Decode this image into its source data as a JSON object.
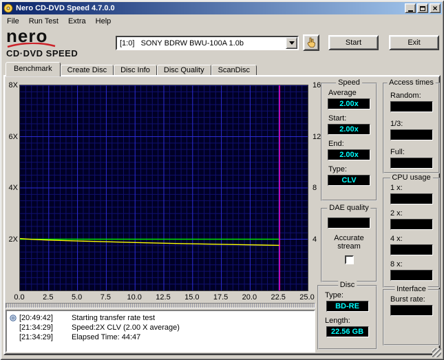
{
  "window": {
    "title": "Nero CD-DVD Speed 4.7.0.0",
    "menu": [
      "File",
      "Run Test",
      "Extra",
      "Help"
    ]
  },
  "toolbar": {
    "logo_line1": "nero",
    "logo_line2": "CD·DVD SPEED",
    "drive_select": "[1:0]   SONY BDRW BWU-100A 1.0b",
    "start_label": "Start",
    "exit_label": "Exit"
  },
  "tabs": [
    {
      "label": "Benchmark",
      "active": true
    },
    {
      "label": "Create Disc",
      "active": false
    },
    {
      "label": "Disc Info",
      "active": false
    },
    {
      "label": "Disc Quality",
      "active": false
    },
    {
      "label": "ScanDisc",
      "active": false
    }
  ],
  "panels": {
    "speed": {
      "title": "Speed",
      "fields": [
        {
          "label": "Average",
          "value": "2.00x"
        },
        {
          "label": "Start:",
          "value": "2.00x"
        },
        {
          "label": "End:",
          "value": "2.00x"
        },
        {
          "label": "Type:",
          "value": "CLV"
        }
      ]
    },
    "access_times": {
      "title": "Access times",
      "fields": [
        {
          "label": "Random:",
          "value": ""
        },
        {
          "label": "1/3:",
          "value": ""
        },
        {
          "label": "Full:",
          "value": ""
        }
      ]
    },
    "cpu_usage": {
      "title": "CPU usage",
      "fields": [
        {
          "label": "1 x:",
          "value": ""
        },
        {
          "label": "2 x:",
          "value": ""
        },
        {
          "label": "4 x:",
          "value": ""
        },
        {
          "label": "8 x:",
          "value": ""
        }
      ]
    },
    "dae_quality": {
      "title": "DAE quality",
      "value": "",
      "checkbox_label": "Accurate stream",
      "checked": false
    },
    "disc": {
      "title": "Disc",
      "fields": [
        {
          "label": "Type:",
          "value": "BD-RE"
        },
        {
          "label": "Length:",
          "value": "22.56 GB"
        }
      ]
    },
    "interface": {
      "title": "Interface",
      "fields": [
        {
          "label": "Burst rate:",
          "value": ""
        }
      ]
    }
  },
  "log": {
    "entries": [
      {
        "time": "[20:49:42]",
        "text": "Starting transfer rate test"
      },
      {
        "time": "[21:34:29]",
        "text": "Speed:2X CLV (2.00 X average)"
      },
      {
        "time": "[21:34:29]",
        "text": "Elapsed Time: 44:47"
      }
    ]
  },
  "colors": {
    "value_text": "#00ffff",
    "field_bg": "#000000",
    "titlebar_a": "#0a246a",
    "titlebar_b": "#a6caf0",
    "window_bg": "#d4d0c8",
    "logo_red": "#cc2229"
  },
  "chart_data": {
    "type": "line",
    "title": "",
    "xlabel": "",
    "xlim": [
      0,
      25
    ],
    "x_ticks": [
      0,
      2.5,
      5,
      7.5,
      10,
      12.5,
      15,
      17.5,
      20,
      22.5,
      25
    ],
    "x_tick_labels": [
      "0.0",
      "2.5",
      "5.0",
      "7.5",
      "10.0",
      "12.5",
      "15.0",
      "17.5",
      "20.0",
      "22.5",
      "25.0"
    ],
    "left_axis": {
      "lim": [
        0,
        8
      ],
      "ticks": [
        2,
        4,
        6,
        8
      ],
      "labels": [
        "2X",
        "4X",
        "6X",
        "8X"
      ]
    },
    "right_axis": {
      "lim": [
        0,
        16
      ],
      "ticks": [
        4,
        8,
        12,
        16
      ],
      "labels": [
        "4",
        "8",
        "12",
        "16"
      ]
    },
    "grid_minor": "#10106e",
    "grid_major": "#2c2cd4",
    "plot_bg": "#000026",
    "series": [
      {
        "name": "read speed",
        "axis": "left",
        "color": "#00e600",
        "x": [
          0,
          22.56
        ],
        "y": [
          2.0,
          2.0
        ]
      },
      {
        "name": "rotation speed",
        "axis": "right",
        "color": "#ffff00",
        "x": [
          0,
          1,
          2.5,
          5,
          7.5,
          10,
          12.5,
          15,
          17.5,
          20,
          22.56
        ],
        "y": [
          4.05,
          3.99,
          3.93,
          3.86,
          3.8,
          3.74,
          3.69,
          3.64,
          3.6,
          3.56,
          3.52
        ]
      }
    ],
    "end_marker": {
      "x": 22.56,
      "color": "#ff00aa"
    },
    "legend": "none",
    "grid": true
  }
}
